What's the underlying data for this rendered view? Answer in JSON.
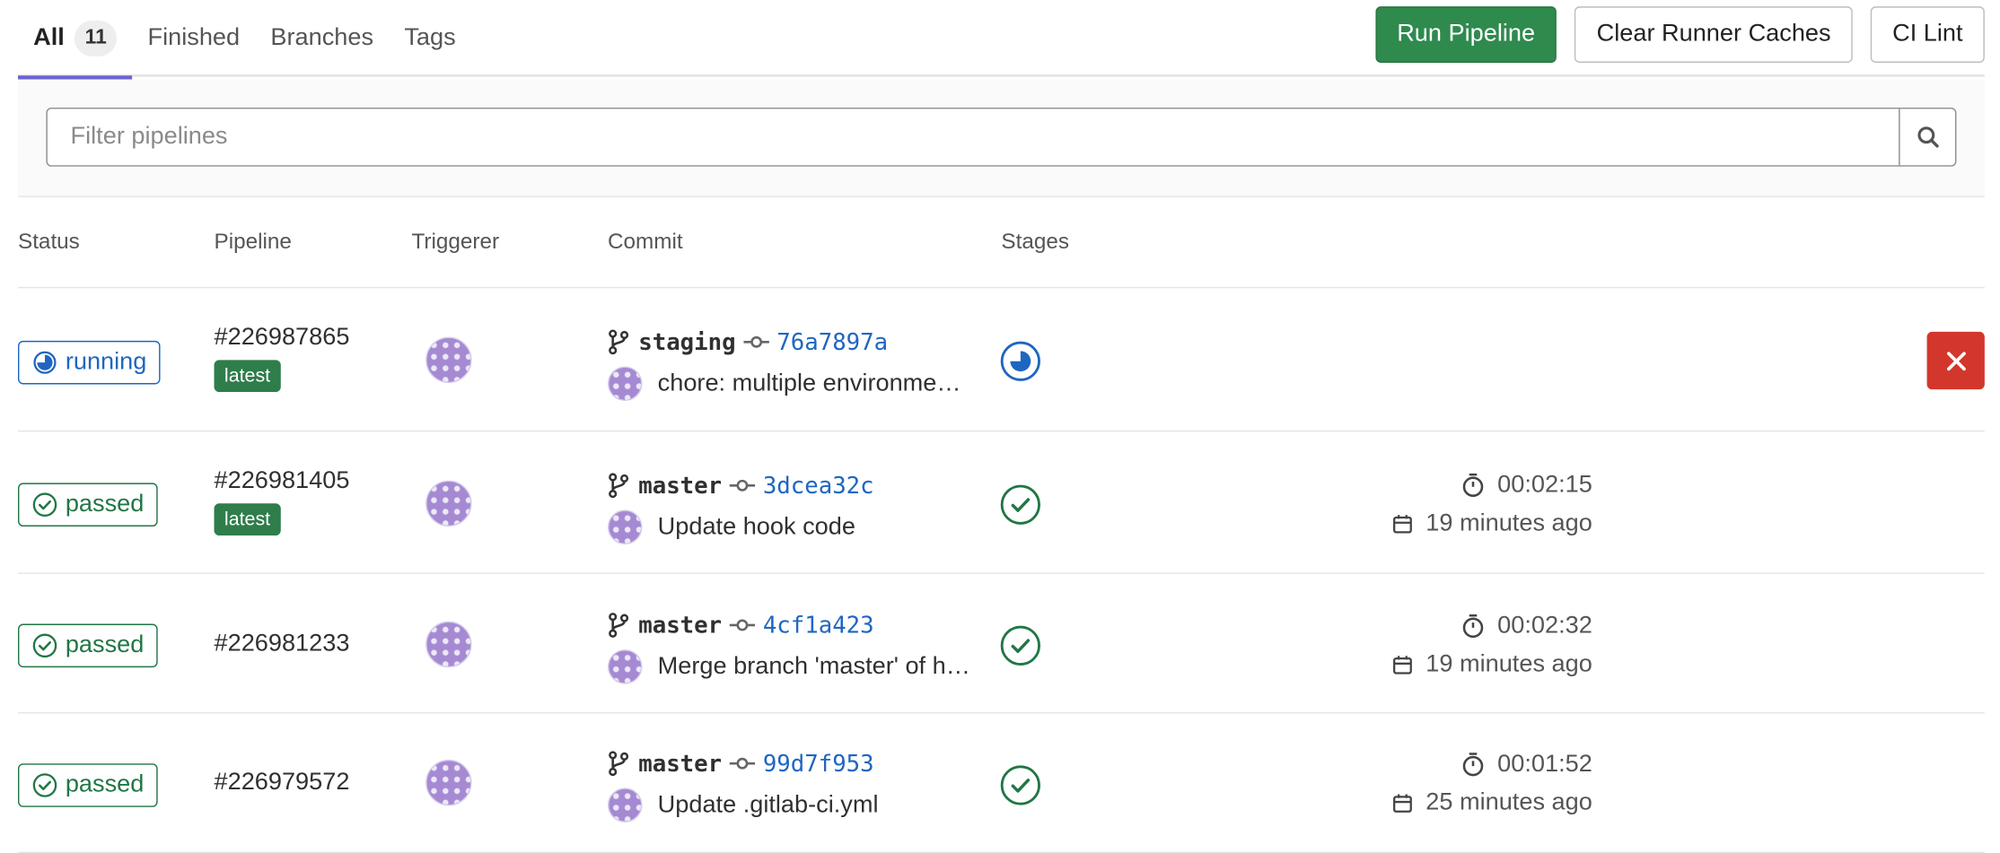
{
  "tabs": [
    {
      "label": "All",
      "count": "11"
    },
    {
      "label": "Finished"
    },
    {
      "label": "Branches"
    },
    {
      "label": "Tags"
    }
  ],
  "actions": {
    "run_pipeline": "Run Pipeline",
    "clear_caches": "Clear Runner Caches",
    "ci_lint": "CI Lint"
  },
  "filter": {
    "placeholder": "Filter pipelines"
  },
  "columns": {
    "status": "Status",
    "pipeline": "Pipeline",
    "triggerer": "Triggerer",
    "commit": "Commit",
    "stages": "Stages"
  },
  "pipelines": [
    {
      "status": "running",
      "id": "#226987865",
      "badge": "latest",
      "branch": "staging",
      "sha": "76a7897a",
      "message": "chore: multiple environme…",
      "duration": "",
      "finished": ""
    },
    {
      "status": "passed",
      "id": "#226981405",
      "badge": "latest",
      "branch": "master",
      "sha": "3dcea32c",
      "message": "Update hook code",
      "duration": "00:02:15",
      "finished": "19 minutes ago"
    },
    {
      "status": "passed",
      "id": "#226981233",
      "badge": "",
      "branch": "master",
      "sha": "4cf1a423",
      "message": "Merge branch 'master' of h…",
      "duration": "00:02:32",
      "finished": "19 minutes ago"
    },
    {
      "status": "passed",
      "id": "#226979572",
      "badge": "",
      "branch": "master",
      "sha": "99d7f953",
      "message": "Update .gitlab-ci.yml",
      "duration": "00:01:52",
      "finished": "25 minutes ago"
    }
  ],
  "colors": {
    "running": "#1f66c1",
    "passed": "#217645",
    "primary": "#2f8a4e",
    "danger": "#d3372b",
    "tab_indicator": "#6b63d2"
  }
}
